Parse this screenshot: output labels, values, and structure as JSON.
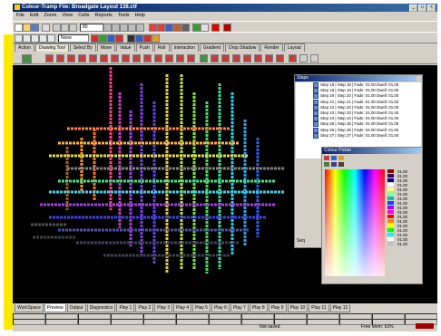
{
  "window": {
    "title": "Colour-Tramp  File: Broadgate Layout 138.ctf"
  },
  "menu": [
    "File",
    "Edit",
    "Zoom",
    "View",
    "Cells",
    "Reports",
    "Tools",
    "Help"
  ],
  "toolbar": {
    "zoom_value": "80",
    "mode_value": "None"
  },
  "tabs": [
    "Action",
    "Drawing Tool",
    "Select By",
    "Move",
    "Value",
    "Push",
    "Roll",
    "Interaction",
    "Gradient",
    "Drop Shadow",
    "Render",
    "Layout"
  ],
  "active_tab": 1,
  "steps_dialog": {
    "title": "Steps",
    "rows": [
      "Step 18 | Step 18 | Fade: 01.00 Dwell: 01.00",
      "Step 19 | Step 19 | Fade: 01.00 Dwell: 01.00",
      "Step 20 | Step 20 | Fade: 01.00 Dwell: 01.00",
      "Step 21 | Step 21 | Fade: 01.00 Dwell: 01.00",
      "Step 22 | Step 22 | Fade: 01.00 Dwell: 01.00",
      "Step 23 | Step 23 | Fade: 01.00 Dwell: 01.00",
      "Step 24 | Step 24 | Fade: 01.00 Dwell: 01.00",
      "Step 25 | Step 25 | Fade: 01.00 Dwell: 01.00",
      "Step 26 | Step 26 | Fade: 01.00 Dwell: 01.00",
      "Step 27 | Step 27 | Fade: 01.00 Dwell: 01.00"
    ],
    "seq_label": "Seq"
  },
  "colour_picker": {
    "title": "Colour Picker",
    "values": [
      "01.00",
      "01.00",
      "01.00",
      "01.00",
      "01.00",
      "01.00",
      "01.00",
      "01.00",
      "01.00",
      "01.00",
      "01.00",
      "01.00",
      "01.00",
      "01.00",
      "01.00",
      "01.00",
      "01.00"
    ],
    "palette": [
      "#8b0000",
      "#3a0050",
      "#000090",
      "#ffffff",
      "#ffff88",
      "#88ff88",
      "#00c0c0",
      "#2040ff",
      "#a000ff",
      "#ff00ff",
      "#ff0000",
      "#ff8800",
      "#ffff00",
      "#00ff00",
      "#00ffff",
      "#ffffff",
      "#c0c0c0"
    ]
  },
  "bottom_tabs": [
    "WorkSpace",
    "Preview",
    "Output",
    "Diagnostics",
    "Play 1",
    "Play 2",
    "Play 3",
    "Play 4",
    "Play 5",
    "Play 6",
    "Play 7",
    "Play 8",
    "Play 9",
    "Play 10",
    "Play 11",
    "Play 12"
  ],
  "active_bottom_tab": 1,
  "status": {
    "saved": "Not saved",
    "memory": "Free Mem: 93%"
  }
}
